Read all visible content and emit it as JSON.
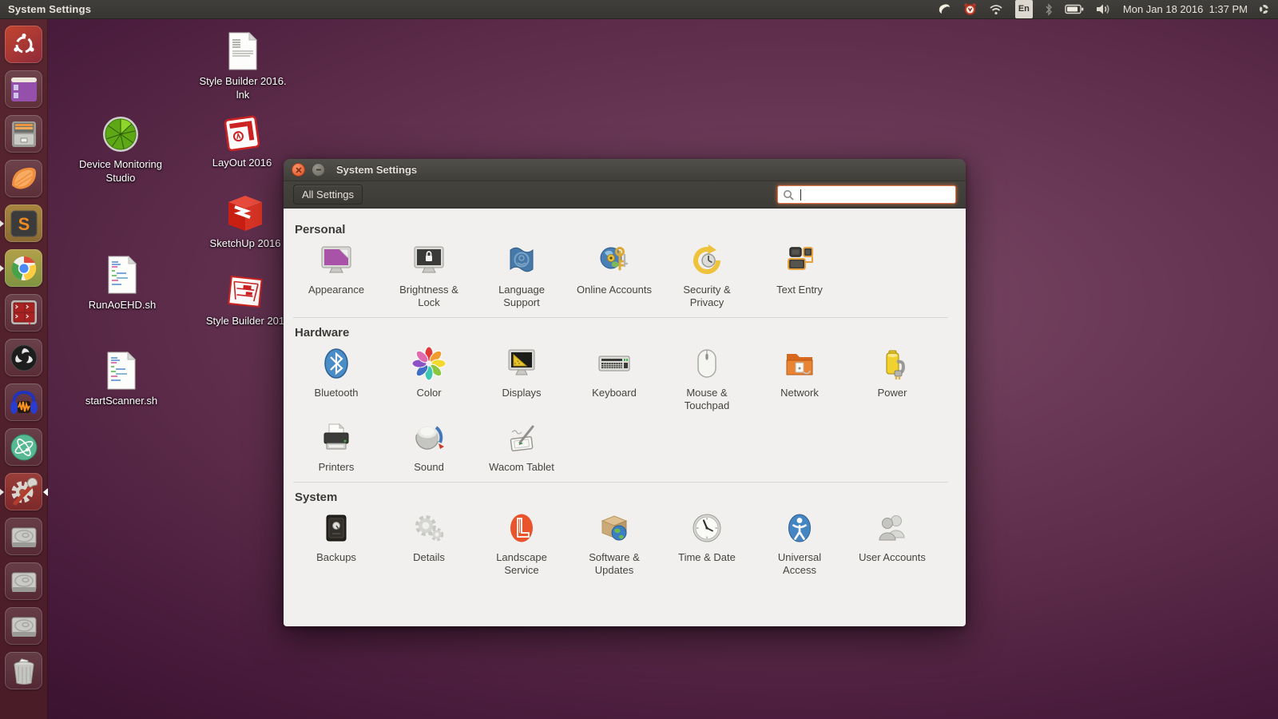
{
  "panel": {
    "app_title": "System Settings",
    "keyboard_layout": "En",
    "clock": "Mon Jan 18 2016  1:37 PM",
    "indicators": [
      "crescent-moon",
      "alarm-clock",
      "wifi",
      "keyboard-layout",
      "bluetooth",
      "battery",
      "volume",
      "clock",
      "session-gear"
    ]
  },
  "launcher": {
    "items": [
      "ubuntu-dash",
      "purple-window-app",
      "file-cabinet",
      "clementine",
      "sublime-text",
      "google-chrome",
      "terminator",
      "obs-studio",
      "audacity",
      "atom",
      "system-settings",
      "hard-disk",
      "hard-disk",
      "hard-disk",
      "trash"
    ]
  },
  "glyphs": {
    "sublime": "S"
  },
  "desktop_icons": [
    {
      "name": "style-builder-lnk",
      "lines": [
        "Style Builder 2016.",
        "lnk"
      ]
    },
    {
      "name": "device-monitoring-studio",
      "lines": [
        "Device Monitoring",
        "Studio"
      ]
    },
    {
      "name": "layout-2016",
      "lines": [
        "LayOut 2016"
      ]
    },
    {
      "name": "sketchup-2016",
      "lines": [
        "SketchUp 2016"
      ]
    },
    {
      "name": "runaoehd-sh",
      "lines": [
        "RunAoEHD.sh"
      ]
    },
    {
      "name": "style-builder-2016",
      "lines": [
        "Style Builder 201"
      ]
    },
    {
      "name": "startscanner-sh",
      "lines": [
        "startScanner.sh"
      ]
    }
  ],
  "window": {
    "title": "System Settings",
    "toolbar": {
      "all_settings_label": "All Settings",
      "search_value": ""
    },
    "sections": [
      {
        "title": "Personal",
        "items": [
          {
            "label": "Appearance"
          },
          {
            "label": "Brightness & Lock"
          },
          {
            "label": "Language Support"
          },
          {
            "label": "Online Accounts"
          },
          {
            "label": "Security & Privacy"
          },
          {
            "label": "Text Entry"
          }
        ]
      },
      {
        "title": "Hardware",
        "items": [
          {
            "label": "Bluetooth"
          },
          {
            "label": "Color"
          },
          {
            "label": "Displays"
          },
          {
            "label": "Keyboard"
          },
          {
            "label": "Mouse & Touchpad"
          },
          {
            "label": "Network"
          },
          {
            "label": "Power"
          },
          {
            "label": "Printers"
          },
          {
            "label": "Sound"
          },
          {
            "label": "Wacom Tablet"
          }
        ]
      },
      {
        "title": "System",
        "items": [
          {
            "label": "Backups"
          },
          {
            "label": "Details"
          },
          {
            "label": "Landscape Service"
          },
          {
            "label": "Software & Updates"
          },
          {
            "label": "Time & Date"
          },
          {
            "label": "Universal Access"
          },
          {
            "label": "User Accounts"
          }
        ]
      }
    ]
  },
  "colors": {
    "accent": "#E95420",
    "panel": "#3C3B37",
    "window_content": "#F1F0EE",
    "wallpaper_center": "#6B3A58"
  }
}
